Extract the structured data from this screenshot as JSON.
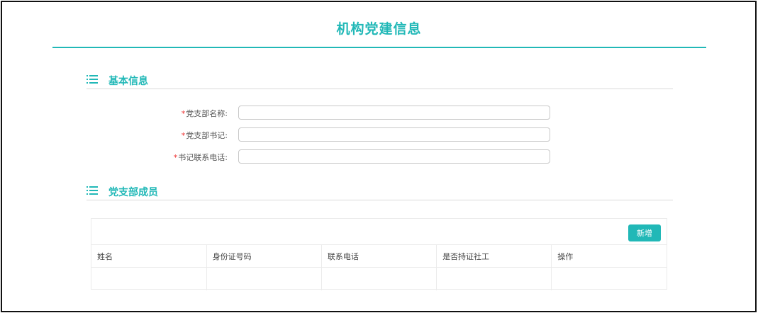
{
  "page": {
    "title": "机构党建信息"
  },
  "sections": {
    "basic": {
      "title": "基本信息"
    },
    "members": {
      "title": "党支部成员"
    }
  },
  "form": {
    "required_mark": "*",
    "fields": [
      {
        "label": "党支部名称:",
        "value": ""
      },
      {
        "label": "党支部书记:",
        "value": ""
      },
      {
        "label": "书记联系电话:",
        "value": ""
      }
    ]
  },
  "members_table": {
    "add_label": "新增",
    "columns": [
      "姓名",
      "身份证号码",
      "联系电话",
      "是否持证社工",
      "操作"
    ],
    "rows": [
      [
        "",
        "",
        "",
        "",
        ""
      ]
    ]
  },
  "colors": {
    "accent": "#21b8b7",
    "required": "#ee3333"
  },
  "icons": {
    "section": "list-icon"
  }
}
